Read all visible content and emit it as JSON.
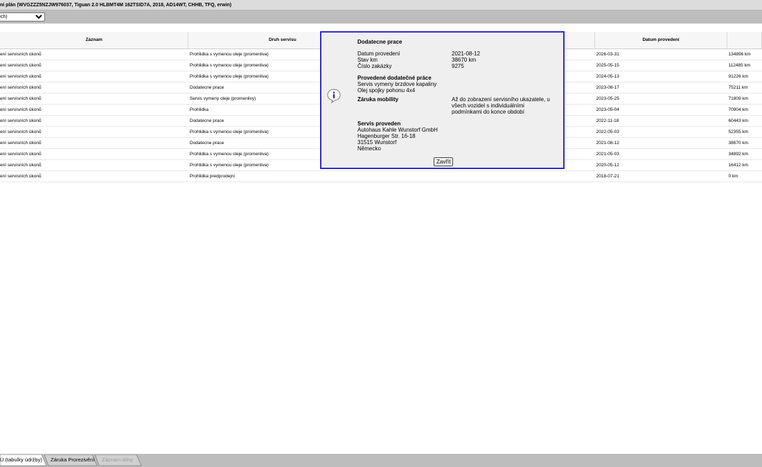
{
  "window": {
    "title": "ní plán (WVGZZZ5NZJW976037, Tiguan 2.0 HLBMT4M 162TSID7A, 2018, AD14WT, CHHB, TFQ, erwin)"
  },
  "toolbar": {
    "select_value": "ech)"
  },
  "table": {
    "headers": [
      "Záznam",
      "Druh servisu",
      "",
      "Datum provedení",
      ""
    ],
    "rows": [
      [
        "ení servisních úkonů",
        "Prohlidka s vymenou oleje (promenliva)",
        "2026-03-31",
        "134896 km"
      ],
      [
        "ení servisních úkonů",
        "Prohlidka s vymenou oleje (promenliva)",
        "2025-05-15",
        "112485 km"
      ],
      [
        "ení servisních úkonů",
        "Prohlidka s vymenou oleje (promenliva)",
        "2024-05-13",
        "91226 km"
      ],
      [
        "ení servisních úkonů",
        "Dodatecne prace",
        "2023-08-17",
        "75211 km"
      ],
      [
        "ení servisních úkonů",
        "Servis vymeny oleje (promenlivy)",
        "2023-05-25",
        "71809 km"
      ],
      [
        "ení servisních úkonů",
        "Prohlidka",
        "2023-05-04",
        "70904 km"
      ],
      [
        "ení servisních úkonů",
        "Dodatecne prace",
        "2022-11-18",
        "60443 km"
      ],
      [
        "ení servisních úkonů",
        "Prohlidka s vymenou oleje (promenliva)",
        "2022-05-03",
        "52355 km"
      ],
      [
        "ení servisních úkonů",
        "Dodatecne prace",
        "2021-08-12",
        "38670 km"
      ],
      [
        "ení servisních úkonů",
        "Prohlidka s vymenou oleje (promenliva)",
        "2021-05-03",
        "34892 km"
      ],
      [
        "ení servisních úkonů",
        "Prohlidka s vymenou oleje (promenliva)",
        "2020-05-12",
        "16412 km"
      ],
      [
        "ení servisních úkonů",
        "Prohlidka predprodejni",
        "2018-07-21",
        "0 km"
      ]
    ]
  },
  "popup": {
    "title": "Dodatecne prace",
    "fields": [
      {
        "label": "Datum provedení",
        "value": "2021-08-12"
      },
      {
        "label": "Stav km",
        "value": "38670 km"
      },
      {
        "label": "Číslo zakázky",
        "value": "9275"
      }
    ],
    "extra_work_heading": "Provedené dodatečné práce",
    "extra_work_items": [
      "Servis vymeny brzdove kapaliny",
      "Olej spojky pohonu 4x4"
    ],
    "mobility_label": "Záruka mobility",
    "mobility_text": [
      "Až do zobrazení servisního ukazatele, u",
      "všech vozidel s individuálními",
      "podmínkami do konce období"
    ],
    "serviced_by_heading": "Servis proveden",
    "serviced_by_lines": [
      "Autohaus Kahle Wunstorf GmbH",
      "Hagenburger Str. 16-18",
      "31515 Wunstorf",
      "Německo"
    ],
    "close_label": "Zavřít",
    "icon": "info-icon",
    "border_color": "#2c2ccc"
  },
  "bottom_tabs": [
    {
      "label": "Ú (tabulky údržby)",
      "active": true,
      "disabled": false
    },
    {
      "label": "Záruka Prorezivění",
      "active": false,
      "disabled": false
    },
    {
      "label": "Záznam dílny",
      "active": false,
      "disabled": true
    }
  ]
}
